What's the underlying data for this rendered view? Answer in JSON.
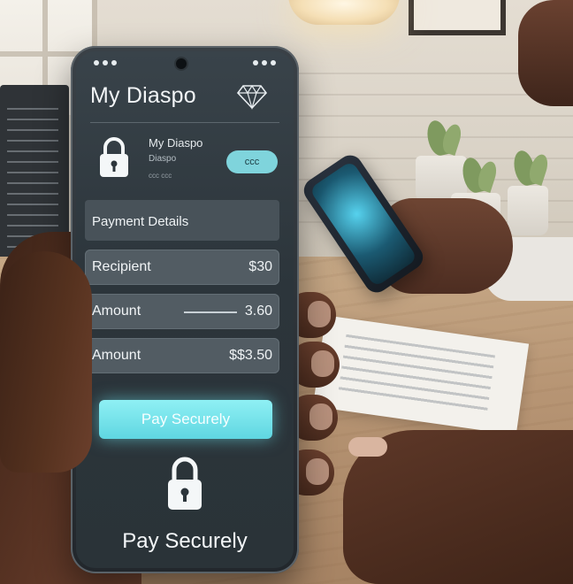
{
  "app": {
    "title": "My Diaspo"
  },
  "account": {
    "name": "My Diaspo",
    "subtitle": "Diaspo",
    "subtitle2": "ᴄᴄᴄ ᴄᴄᴄ",
    "pill_label": "ᴄᴄᴄ"
  },
  "payment": {
    "section_label": "Payment Details",
    "rows": [
      {
        "label": "Recipient",
        "value": "$30"
      },
      {
        "label": "Amount",
        "value": "3.60"
      },
      {
        "label": "Amount",
        "value": "$$3.50"
      }
    ]
  },
  "actions": {
    "pay_button_label": "Pay Securely"
  },
  "footer": {
    "text": "Pay Securely"
  },
  "colors": {
    "accent": "#7fd4dc",
    "screen_bg": "#2c353b",
    "row_bg": "#525c63"
  },
  "icons": {
    "brand": "diamond-icon",
    "account": "lock-icon",
    "footer": "lock-icon"
  }
}
